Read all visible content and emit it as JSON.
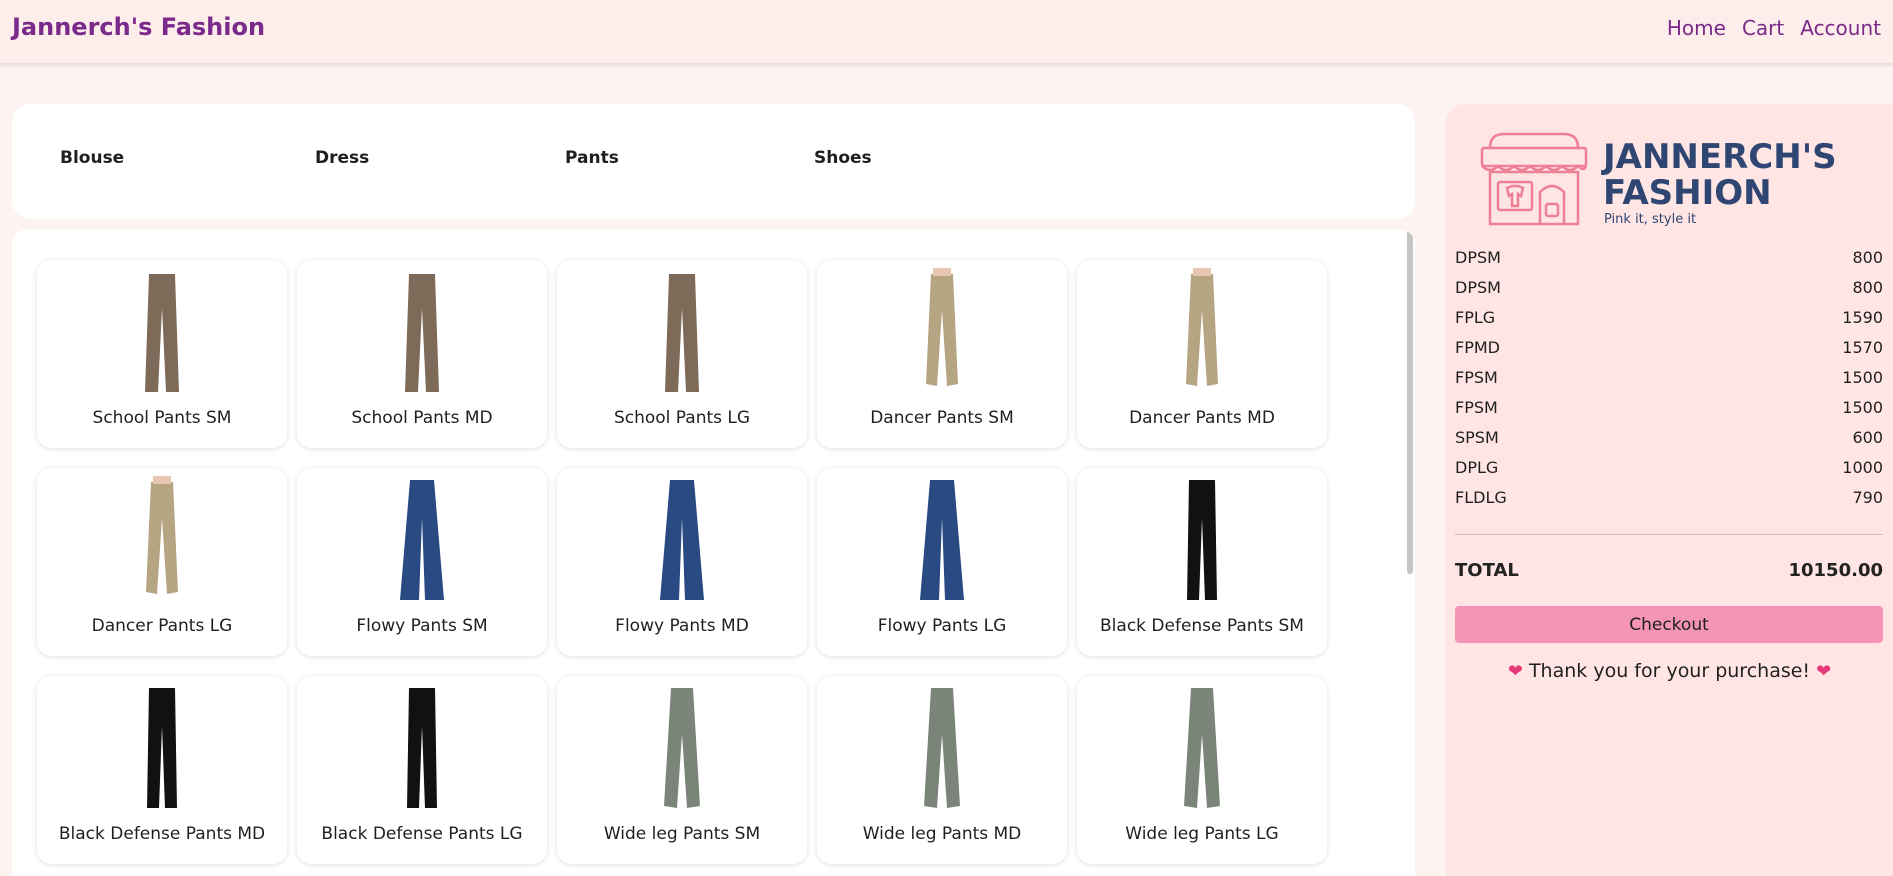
{
  "header": {
    "brand": "Jannerch's Fashion",
    "nav": [
      "Home",
      "Cart",
      "Account"
    ]
  },
  "categories": [
    "Blouse",
    "Dress",
    "Pants",
    "Shoes"
  ],
  "products": [
    {
      "name": "School Pants SM",
      "style": "school"
    },
    {
      "name": "School Pants MD",
      "style": "school"
    },
    {
      "name": "School Pants LG",
      "style": "school"
    },
    {
      "name": "Dancer Pants SM",
      "style": "dancer"
    },
    {
      "name": "Dancer Pants MD",
      "style": "dancer"
    },
    {
      "name": "Dancer Pants LG",
      "style": "dancer"
    },
    {
      "name": "Flowy Pants SM",
      "style": "flowy"
    },
    {
      "name": "Flowy Pants MD",
      "style": "flowy"
    },
    {
      "name": "Flowy Pants LG",
      "style": "flowy"
    },
    {
      "name": "Black Defense Pants SM",
      "style": "black"
    },
    {
      "name": "Black Defense Pants MD",
      "style": "black"
    },
    {
      "name": "Black Defense Pants LG",
      "style": "black"
    },
    {
      "name": "Wide leg Pants SM",
      "style": "wideleg"
    },
    {
      "name": "Wide leg Pants MD",
      "style": "wideleg"
    },
    {
      "name": "Wide leg Pants LG",
      "style": "wideleg"
    }
  ],
  "product_colors": {
    "school": "#7d6a58",
    "dancer": "#b6a583",
    "flowy": "#2a4a84",
    "black": "#111111",
    "wideleg": "#7a8478"
  },
  "logo": {
    "line1": "JANNERCH'S",
    "line2": "FASHION",
    "tagline": "Pink it, style it",
    "text_color": "#2f4672",
    "icon_color": "#ee7f95"
  },
  "order": {
    "items": [
      {
        "code": "DPSM",
        "price": "800"
      },
      {
        "code": "DPSM",
        "price": "800"
      },
      {
        "code": "FPLG",
        "price": "1590"
      },
      {
        "code": "FPMD",
        "price": "1570"
      },
      {
        "code": "FPSM",
        "price": "1500"
      },
      {
        "code": "FPSM",
        "price": "1500"
      },
      {
        "code": "SPSM",
        "price": "600"
      },
      {
        "code": "DPLG",
        "price": "1000"
      },
      {
        "code": "FLDLG",
        "price": "790"
      }
    ],
    "total_label": "TOTAL",
    "total_value": "10150.00",
    "checkout_label": "Checkout",
    "thanks": "Thank you for your purchase!"
  }
}
